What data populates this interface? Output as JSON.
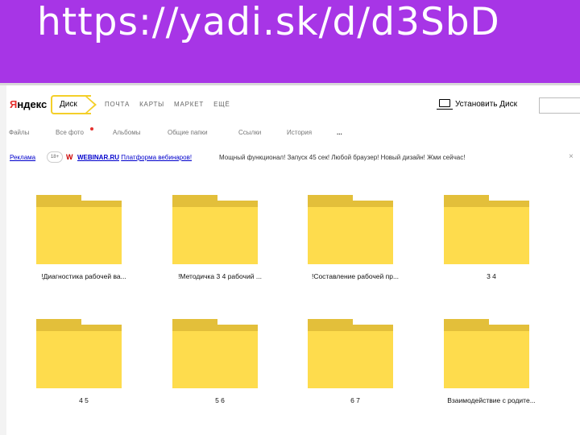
{
  "slide": {
    "title": "https://yadi.sk/d/d3SbD"
  },
  "header": {
    "logo_part1": "Я",
    "logo_part2": "ндекс",
    "disk_tab": "Диск",
    "services": [
      "ПОЧТА",
      "КАРТЫ",
      "МАРКЕТ",
      "ЕЩЁ"
    ],
    "install": "Установить Диск"
  },
  "nav": {
    "items": [
      "Файлы",
      "Все фото",
      "Альбомы",
      "Общие папки",
      "Ссылки",
      "История",
      "..."
    ]
  },
  "ad": {
    "label": "Реклама",
    "age": "18+",
    "brand_letter": "W",
    "link_site": "WEBINAR.RU",
    "link_text": "Платформа вебинаров!",
    "description": "Мощный функционал! Запуск 45 сек! Любой браузер! Новый дизайн! Жми сейчас!",
    "close": "×"
  },
  "folders": [
    {
      "name": "!Диагностика рабочей ва..."
    },
    {
      "name": "!Методичка 3 4 рабочий ..."
    },
    {
      "name": "!Составление рабочей пр..."
    },
    {
      "name": "3 4"
    },
    {
      "name": "4 5"
    },
    {
      "name": "5 6"
    },
    {
      "name": "6 7"
    },
    {
      "name": "Взаимодействие с родите..."
    }
  ],
  "colors": {
    "band": "#a735e6",
    "folder_front": "#fedc4d",
    "folder_back": "#e3bf3a",
    "accent_yellow": "#f4cf29",
    "link": "#0000cc"
  }
}
